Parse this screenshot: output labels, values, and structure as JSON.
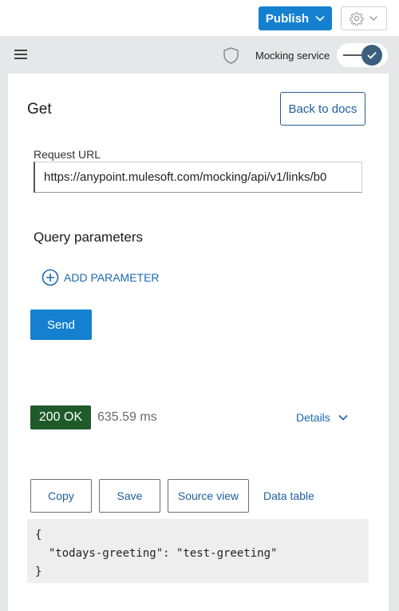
{
  "header": {
    "publish_label": "Publish",
    "mocking_label": "Mocking service",
    "mocking_enabled": true
  },
  "request": {
    "method": "Get",
    "back_label": "Back to docs",
    "url_label": "Request URL",
    "url_value": "https://anypoint.mulesoft.com/mocking/api/v1/links/b0",
    "query_title": "Query parameters",
    "add_param_label": "ADD PARAMETER",
    "send_label": "Send"
  },
  "response": {
    "status": "200 OK",
    "time": "635.59 ms",
    "details_label": "Details",
    "actions": {
      "copy": "Copy",
      "save": "Save",
      "source": "Source view",
      "table": "Data table"
    },
    "body_lines": [
      "{",
      "  \"todays-greeting\": \"test-greeting\"",
      "}"
    ]
  },
  "colors": {
    "primary": "#1580d0",
    "link": "#1d68b0",
    "status_ok": "#1f5a2a",
    "toolbar": "#e6e7e8",
    "toggle_knob": "#3b5f7d"
  }
}
